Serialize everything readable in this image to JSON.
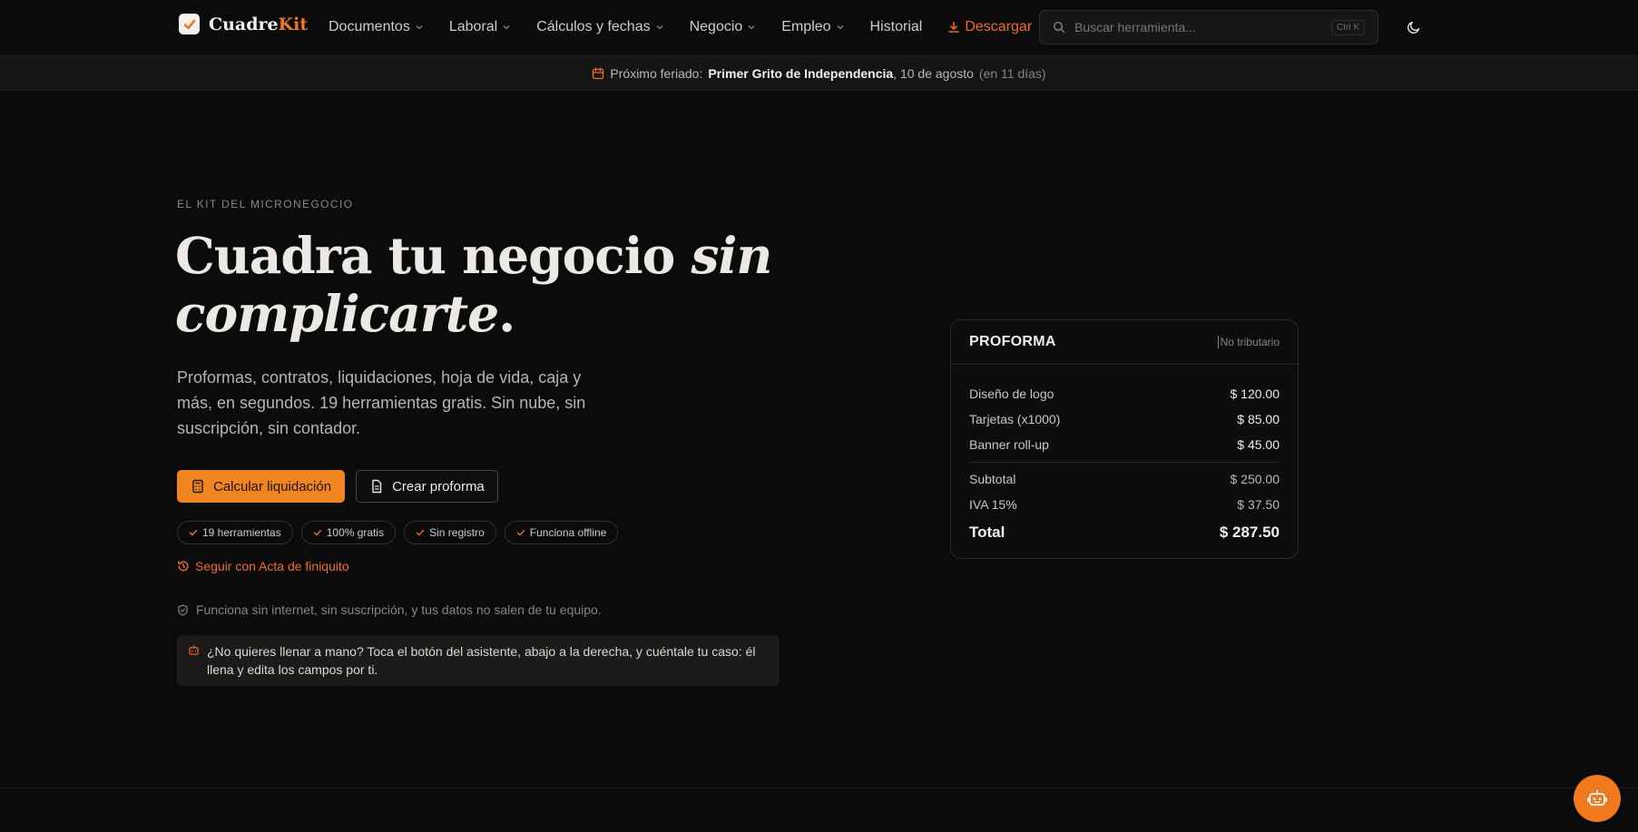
{
  "brand": {
    "name_a": "Cuadre",
    "name_b": "Kit"
  },
  "nav": {
    "items": [
      {
        "label": "Documentos",
        "dropdown": true
      },
      {
        "label": "Laboral",
        "dropdown": true
      },
      {
        "label": "Cálculos y fechas",
        "dropdown": true
      },
      {
        "label": "Negocio",
        "dropdown": true
      },
      {
        "label": "Empleo",
        "dropdown": true
      },
      {
        "label": "Historial",
        "dropdown": false
      }
    ],
    "download_label": "Descargar",
    "search_placeholder": "Buscar herramienta...",
    "search_shortcut": "Ctrl K"
  },
  "holiday": {
    "prefix": "Próximo feriado:",
    "name": "Primer Grito de Independencia",
    "date": ", 10 de agosto",
    "relative": "(en 11 días)"
  },
  "hero": {
    "eyebrow": "EL KIT DEL MICRONEGOCIO",
    "title_a": "Cuadra tu negocio ",
    "title_b": "sin complicarte",
    "title_c": ".",
    "lead": "Proformas, contratos, liquidaciones, hoja de vida, caja y más, en segundos. 19 herramientas gratis. Sin nube, sin suscripción, sin contador.",
    "primary_cta": "Calcular liquidación",
    "secondary_cta": "Crear proforma",
    "pills": [
      "19 herramientas",
      "100% gratis",
      "Sin registro",
      "Funciona offline"
    ],
    "continue_label": "Seguir con Acta de finiquito",
    "privacy": "Funciona sin internet, sin suscripción, y tus datos no salen de tu equipo.",
    "assistant_note": "¿No quieres llenar a mano? Toca el botón del asistente, abajo a la derecha, y cuéntale tu caso: él llena y edita los campos por ti."
  },
  "proforma": {
    "title": "PROFORMA",
    "tag": "No tributario",
    "items": [
      {
        "label": "Diseño de logo",
        "value": "$ 120.00"
      },
      {
        "label": "Tarjetas (x1000)",
        "value": "$ 85.00"
      },
      {
        "label": "Banner roll-up",
        "value": "$ 45.00"
      }
    ],
    "subtotal_label": "Subtotal",
    "subtotal": "$ 250.00",
    "tax_label": "IVA 15%",
    "tax": "$ 37.50",
    "total_label": "Total",
    "total": "$ 287.50"
  },
  "colors": {
    "accent": "#f0791f",
    "link": "#f06a28",
    "background": "#0b0b0b"
  }
}
